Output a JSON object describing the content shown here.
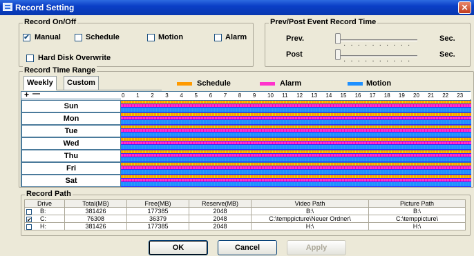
{
  "window": {
    "title": "Record Setting",
    "close_glyph": "✕"
  },
  "record_onoff": {
    "title": "Record On/Off",
    "manual": {
      "label": "Manual",
      "checked": true
    },
    "schedule": {
      "label": "Schedule",
      "checked": false
    },
    "motion": {
      "label": "Motion",
      "checked": false
    },
    "alarm": {
      "label": "Alarm",
      "checked": false
    },
    "hdd_overwrite": {
      "label": "Hard Disk Overwrite",
      "checked": false
    }
  },
  "prevpost": {
    "title": "Prev/Post Event Record Time",
    "prev_label": "Prev.",
    "post_label": "Post",
    "unit": "Sec.",
    "prev_value": 0,
    "post_value": 0
  },
  "time_range": {
    "title": "Record Time Range",
    "tabs": [
      "Weekly",
      "Custom"
    ],
    "legend": [
      {
        "label": "Schedule",
        "color": "#ff9a00"
      },
      {
        "label": "Alarm",
        "color": "#ff33cc"
      },
      {
        "label": "Motion",
        "color": "#1e90ff"
      }
    ],
    "zoom_plus": "+",
    "zoom_minus": "—",
    "hours": [
      "0",
      "1",
      "2",
      "3",
      "4",
      "5",
      "6",
      "7",
      "8",
      "9",
      "10",
      "11",
      "12",
      "13",
      "14",
      "15",
      "16",
      "17",
      "18",
      "19",
      "20",
      "21",
      "22",
      "23"
    ],
    "days": [
      "Sun",
      "Mon",
      "Tue",
      "Wed",
      "Thu",
      "Fri",
      "Sat"
    ]
  },
  "record_path": {
    "title": "Record Path",
    "columns": [
      "Drive",
      "Total(MB)",
      "Free(MB)",
      "Reserve(MB)",
      "Video Path",
      "Picture Path"
    ],
    "rows": [
      {
        "checked": false,
        "drive": "B:",
        "total": "381426",
        "free": "177385",
        "reserve": "2048",
        "video": "B:\\",
        "picture": "B:\\"
      },
      {
        "checked": true,
        "drive": "C:",
        "total": "76308",
        "free": "36379",
        "reserve": "2048",
        "video": "C:\\temppicture\\Neuer Ordner\\",
        "picture": "C:\\temppicture\\"
      },
      {
        "checked": false,
        "drive": "H:",
        "total": "381426",
        "free": "177385",
        "reserve": "2048",
        "video": "H:\\",
        "picture": "H:\\"
      }
    ]
  },
  "buttons": {
    "ok": "OK",
    "cancel": "Cancel",
    "apply": "Apply"
  }
}
